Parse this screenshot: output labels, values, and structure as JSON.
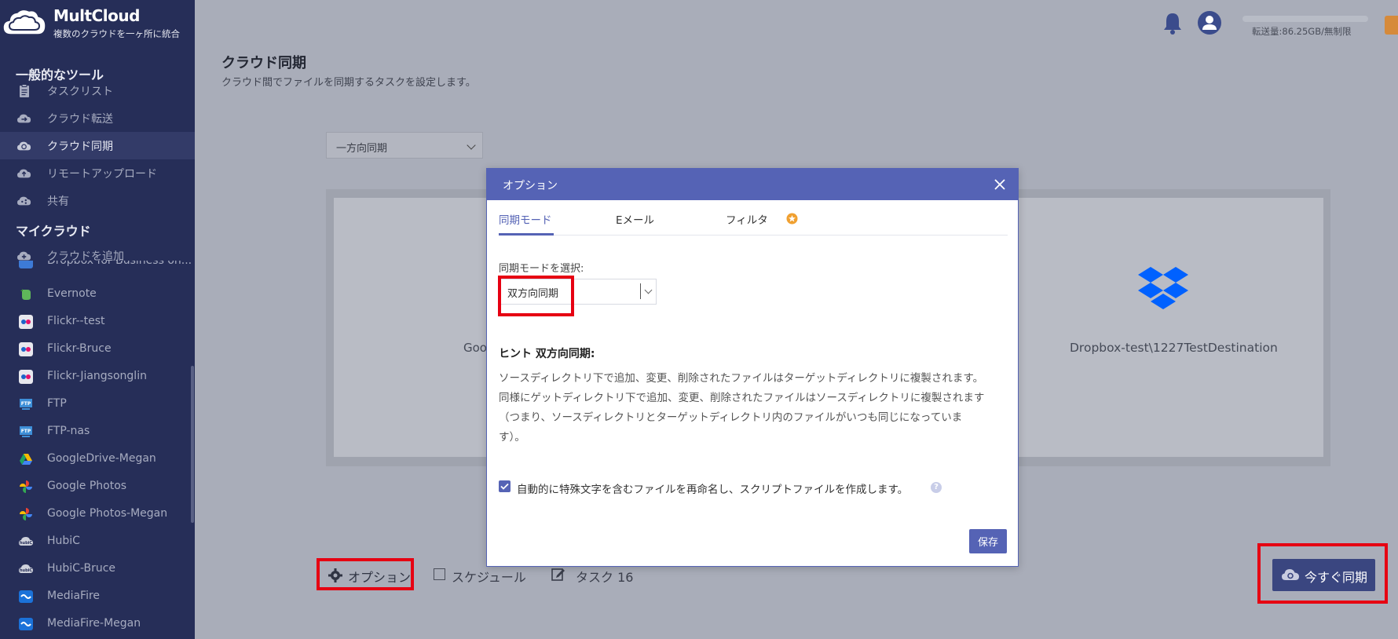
{
  "brand": {
    "name": "MultCloud",
    "tagline": "複数のクラウドを一ヶ所に統合"
  },
  "sidebar": {
    "general_title": "一般的なツール",
    "tools": [
      {
        "label": "タスクリスト",
        "icon": "clipboard-icon"
      },
      {
        "label": "クラウド転送",
        "icon": "cloud-transfer-icon"
      },
      {
        "label": "クラウド同期",
        "icon": "cloud-sync-icon",
        "active": true
      },
      {
        "label": "リモートアップロード",
        "icon": "cloud-upload-icon"
      },
      {
        "label": "共有",
        "icon": "cloud-share-icon"
      }
    ],
    "mycloud_title": "マイクラウド",
    "add_cloud": "クラウドを追加",
    "clouds": [
      {
        "label": "Dropbox for Business oh...",
        "icon": "dropbox-icon"
      },
      {
        "label": "Evernote",
        "icon": "evernote-icon"
      },
      {
        "label": "Flickr--test",
        "icon": "flickr-icon"
      },
      {
        "label": "Flickr-Bruce",
        "icon": "flickr-icon"
      },
      {
        "label": "Flickr-Jiangsonglin",
        "icon": "flickr-icon"
      },
      {
        "label": "FTP",
        "icon": "ftp-icon"
      },
      {
        "label": "FTP-nas",
        "icon": "ftp-icon"
      },
      {
        "label": "GoogleDrive-Megan",
        "icon": "google-drive-icon"
      },
      {
        "label": "Google Photos",
        "icon": "google-photos-icon"
      },
      {
        "label": "Google Photos-Megan",
        "icon": "google-photos-icon"
      },
      {
        "label": "HubiC",
        "icon": "hubic-icon"
      },
      {
        "label": "HubiC-Bruce",
        "icon": "hubic-icon"
      },
      {
        "label": "MediaFire",
        "icon": "mediafire-icon"
      },
      {
        "label": "MediaFire-Megan",
        "icon": "mediafire-icon"
      }
    ]
  },
  "header": {
    "quota": "転送量:86.25GB/無制限"
  },
  "main": {
    "title": "クラウド同期",
    "subtitle": "クラウド間でファイルを同期するタスクを設定します。",
    "mode_select": "一方向同期",
    "source_text": "Goo",
    "destination_text": "Dropbox-test\\1227TestDestination"
  },
  "bottom": {
    "options": "オプション",
    "schedule": "スケジュール",
    "task": "タスク 16",
    "sync_now": "今すぐ同期"
  },
  "modal": {
    "title": "オプション",
    "tabs": [
      "同期モード",
      "Eメール",
      "フィルタ"
    ],
    "select_label": "同期モードを選択:",
    "select_value": "双方向同期",
    "hint_title": "ヒント 双方向同期:",
    "hint_lines": [
      "ソースディレクトリ下で追加、変更、削除されたファイルはターゲットディレクトリに複製されます。",
      "同様にゲットディレクトリ下で追加、変更、削除されたファイルはソースディレクトリに複製されます",
      "（つまり、ソースディレクトリとターゲットディレクトリ内のファイルがいつも同じになっていま",
      "す）。"
    ],
    "checkbox_label": "自動的に特殊文字を含むファイルを再命名し、スクリプトファイルを作成します。",
    "help": "?",
    "save": "保存"
  },
  "colors": {
    "sidebar_bg": "#262e58",
    "accent": "#5563b5",
    "highlight": "#e60012"
  }
}
